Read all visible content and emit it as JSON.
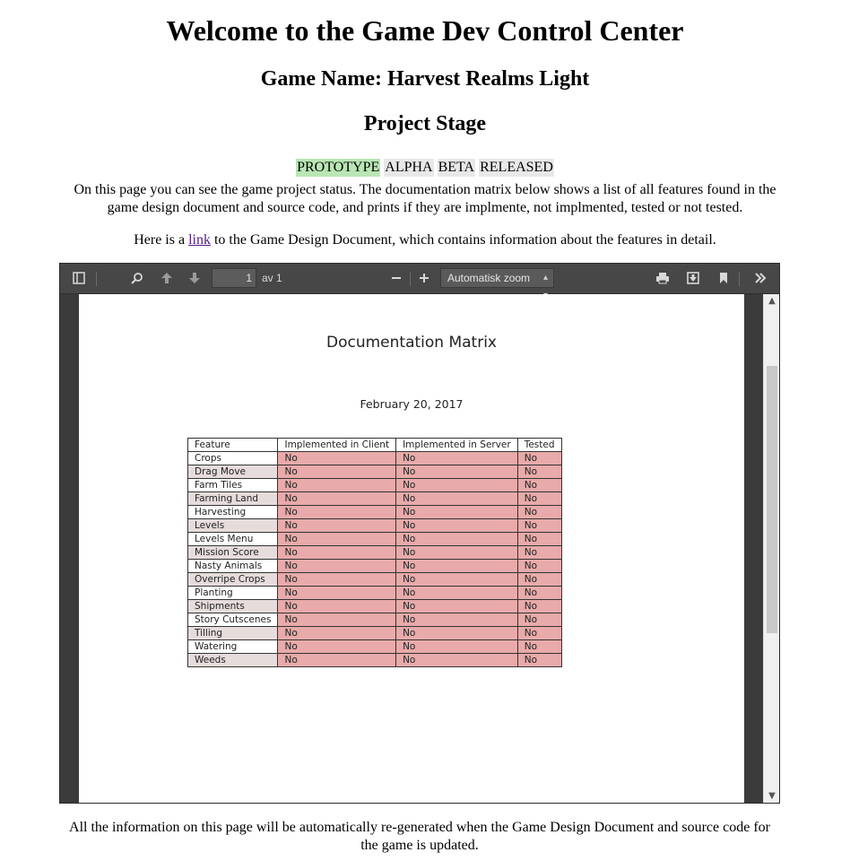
{
  "header": {
    "title": "Welcome to the Game Dev Control Center",
    "game_name": "Game Name: Harvest Realms Light",
    "stage_heading": "Project Stage"
  },
  "stages": [
    {
      "label": "PROTOTYPE",
      "active": true
    },
    {
      "label": "ALPHA",
      "active": false
    },
    {
      "label": "BETA",
      "active": false
    },
    {
      "label": "RELEASED",
      "active": false
    }
  ],
  "intro": {
    "text": "On this page you can see the game project status. The documentation matrix below shows a list of all features found in the game design document and source code, and prints if they are implmente, not implmented, tested or not tested.",
    "link_prefix": "Here is a ",
    "link_text": "link",
    "link_suffix": " to the Game Design Document, which contains information about the features in detail."
  },
  "viewer": {
    "toolbar": {
      "page_number": "1",
      "page_of": "av 1",
      "zoom": "Automatisk zoom"
    },
    "icons": [
      "sidebar-toggle-icon",
      "search-icon",
      "arrow-up-icon",
      "arrow-down-icon",
      "zoom-out-icon",
      "zoom-in-icon",
      "print-icon",
      "download-icon",
      "bookmark-icon",
      "more-tools-icon"
    ],
    "document": {
      "title": "Documentation Matrix",
      "date": "February 20, 2017",
      "columns": [
        "Feature",
        "Implemented in Client",
        "Implemented in Server",
        "Tested"
      ],
      "rows": [
        [
          "Crops",
          "No",
          "No",
          "No"
        ],
        [
          "Drag Move",
          "No",
          "No",
          "No"
        ],
        [
          "Farm Tiles",
          "No",
          "No",
          "No"
        ],
        [
          "Farming Land",
          "No",
          "No",
          "No"
        ],
        [
          "Harvesting",
          "No",
          "No",
          "No"
        ],
        [
          "Levels",
          "No",
          "No",
          "No"
        ],
        [
          "Levels Menu",
          "No",
          "No",
          "No"
        ],
        [
          "Mission Score",
          "No",
          "No",
          "No"
        ],
        [
          "Nasty Animals",
          "No",
          "No",
          "No"
        ],
        [
          "Overripe Crops",
          "No",
          "No",
          "No"
        ],
        [
          "Planting",
          "No",
          "No",
          "No"
        ],
        [
          "Shipments",
          "No",
          "No",
          "No"
        ],
        [
          "Story Cutscenes",
          "No",
          "No",
          "No"
        ],
        [
          "Tilling",
          "No",
          "No",
          "No"
        ],
        [
          "Watering",
          "No",
          "No",
          "No"
        ],
        [
          "Weeds",
          "No",
          "No",
          "No"
        ]
      ]
    }
  },
  "footer": {
    "text": "All the information on this page will be automatically re-generated when the Game Design Document and source code for the game is updated."
  },
  "colors": {
    "active_stage": "#b9e6b4",
    "inactive_stage": "#e8e8e8",
    "not_done_cell": "#e8aaaa",
    "toolbar": "#474747"
  }
}
